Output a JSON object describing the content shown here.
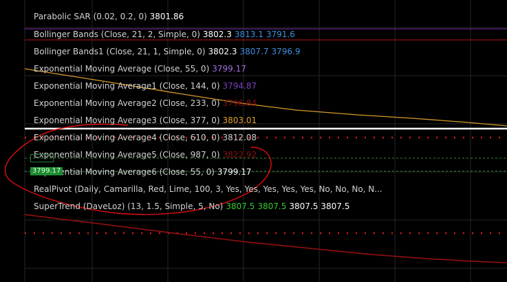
{
  "indicators": [
    {
      "label": "Parabolic SAR (0.02, 0.2, 0)",
      "values": [
        {
          "text": "3801.86",
          "color": "#ffffff"
        }
      ]
    },
    {
      "label": "Bollinger Bands (Close, 21, 2, Simple, 0)",
      "values": [
        {
          "text": "3802.3",
          "color": "#ffffff"
        },
        {
          "text": "3813.1",
          "color": "#3d8fe0"
        },
        {
          "text": "3791.6",
          "color": "#3d8fe0"
        }
      ]
    },
    {
      "label": "Bollinger Bands1 (Close, 21, 1, Simple, 0)",
      "values": [
        {
          "text": "3802.3",
          "color": "#ffffff"
        },
        {
          "text": "3807.7",
          "color": "#3d8fe0"
        },
        {
          "text": "3796.9",
          "color": "#3d8fe0"
        }
      ]
    },
    {
      "label": "Exponential Moving Average (Close, 55, 0)",
      "values": [
        {
          "text": "3799.17",
          "color": "#a070e0"
        }
      ]
    },
    {
      "label": "Exponential Moving Average1 (Close, 144, 0)",
      "values": [
        {
          "text": "3794.87",
          "color": "#7a3fc0"
        }
      ]
    },
    {
      "label": "Exponential Moving Average2 (Close, 233, 0)",
      "values": [
        {
          "text": "3796.84",
          "color": "#8b1010"
        }
      ]
    },
    {
      "label": "Exponential Moving Average3 (Close, 377, 0)",
      "values": [
        {
          "text": "3803.01",
          "color": "#e0a030"
        }
      ]
    },
    {
      "label": "Exponential Moving Average4 (Close, 610, 0)",
      "values": [
        {
          "text": "3812.08",
          "color": "#d0d0d0"
        }
      ]
    },
    {
      "label": "Exponential Moving Average5 (Close, 987, 0)",
      "values": [
        {
          "text": "3822.92",
          "color": "#8b1010"
        }
      ]
    },
    {
      "label": "Exponential Moving Average6 (Close, 55, 0)",
      "values": [
        {
          "text": "3799.17",
          "color": "#ffffff"
        }
      ]
    },
    {
      "label": "RealPivot (Daily, Camarilla, Red, Lime, 100, 3, Yes, Yes, Yes, Yes, Yes, No, No, No, N...",
      "values": []
    },
    {
      "label": "SuperTrend (DaveLoz) (13, 1.5, Simple, 5, No)",
      "values": [
        {
          "text": "3807.5",
          "color": "#33cc33"
        },
        {
          "text": "3807.5",
          "color": "#33cc33"
        },
        {
          "text": "3807.5",
          "color": "#ffffff"
        },
        {
          "text": "3807.5",
          "color": "#ffffff"
        }
      ]
    }
  ],
  "price_tag": {
    "text": "3799.17"
  },
  "colors": {
    "background": "#000000",
    "grid": "#2a2a2a",
    "bollinger": "#7a2fb0",
    "ema_orange": "#d89a2a",
    "ema_white": "#ffffff",
    "pivot_dots": "#e01818",
    "pivot_green": "#2e8b3a",
    "supertrend": "#9a1010",
    "annotation": "#e01010"
  }
}
